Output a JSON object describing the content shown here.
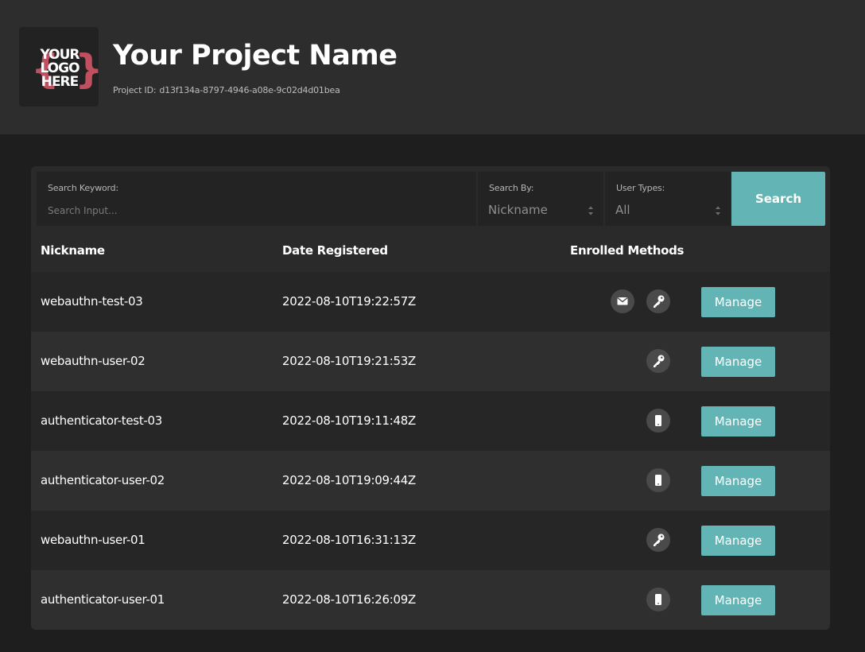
{
  "header": {
    "logo_text": [
      "YOUR",
      "LOGO",
      "HERE"
    ],
    "title": "Your Project Name",
    "project_id_label": "Project ID:",
    "project_id": "d13f134a-8797-4946-a08e-9c02d4d01bea"
  },
  "filters": {
    "keyword_label": "Search Keyword:",
    "keyword_placeholder": "Search Input...",
    "keyword_value": "",
    "search_by_label": "Search By:",
    "search_by_value": "Nickname",
    "user_types_label": "User Types:",
    "user_types_value": "All",
    "search_button": "Search"
  },
  "table": {
    "columns": [
      "Nickname",
      "Date Registered",
      "Enrolled Methods"
    ],
    "rows": [
      {
        "nickname": "webauthn-test-03",
        "date": "2022-08-10T19:22:57Z",
        "methods": [
          "email-icon",
          "key-icon"
        ],
        "action": "Manage"
      },
      {
        "nickname": "webauthn-user-02",
        "date": "2022-08-10T19:21:53Z",
        "methods": [
          "key-icon"
        ],
        "action": "Manage"
      },
      {
        "nickname": "authenticator-test-03",
        "date": "2022-08-10T19:11:48Z",
        "methods": [
          "phone-icon"
        ],
        "action": "Manage"
      },
      {
        "nickname": "authenticator-user-02",
        "date": "2022-08-10T19:09:44Z",
        "methods": [
          "phone-icon"
        ],
        "action": "Manage"
      },
      {
        "nickname": "webauthn-user-01",
        "date": "2022-08-10T16:31:13Z",
        "methods": [
          "key-icon"
        ],
        "action": "Manage"
      },
      {
        "nickname": "authenticator-user-01",
        "date": "2022-08-10T16:26:09Z",
        "methods": [
          "phone-icon"
        ],
        "action": "Manage"
      }
    ]
  },
  "colors": {
    "accent": "#62b5b4",
    "logo_brace": "#c0505f",
    "page_bg": "#1e1e1f",
    "header_bg": "#2d2d2e"
  }
}
